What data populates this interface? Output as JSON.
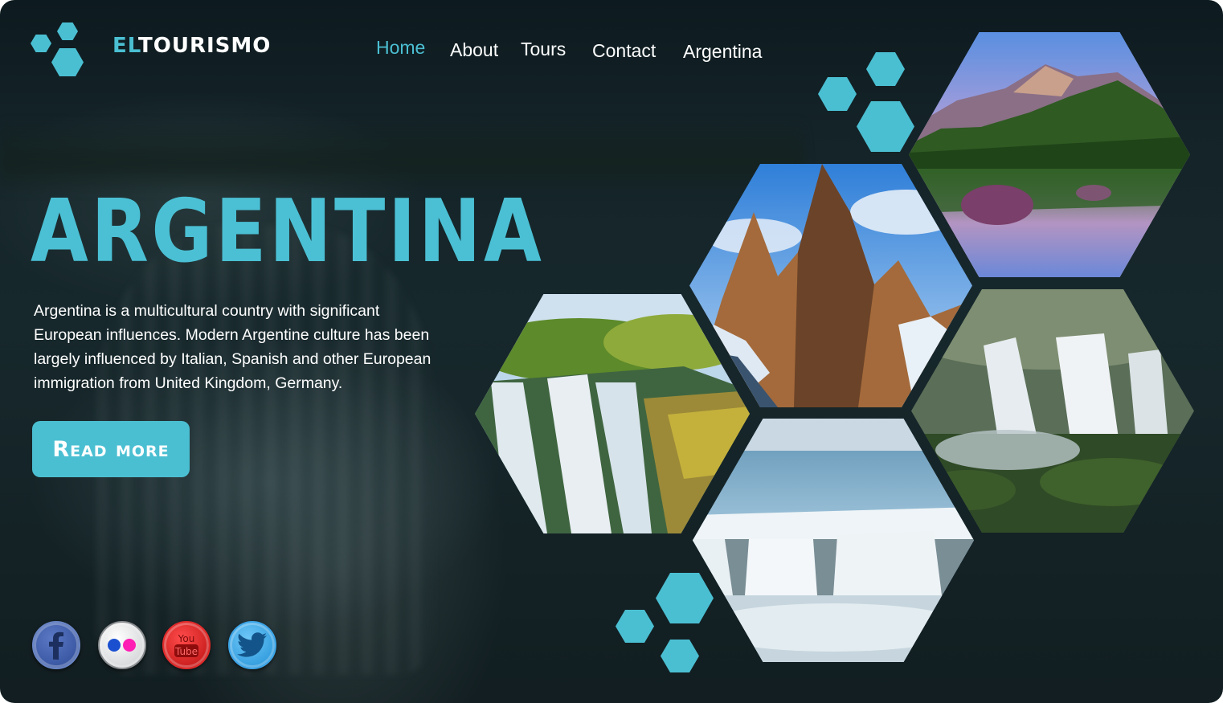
{
  "brand": {
    "prefix": "El",
    "name": "TOURISMO"
  },
  "nav": {
    "home": "Home",
    "about": "About",
    "tours": "Tours",
    "contact": "Contact",
    "argentina": "Argentina"
  },
  "hero": {
    "title": "ARGENTINA",
    "description": "Argentina is a multicultural country with significant European influences. Modern Argentine culture has been largely influenced by Italian, Spanish and other European immigration from United Kingdom, Germany.",
    "cta": "Read more"
  },
  "social": {
    "youtube_top": "You",
    "youtube_bottom": "Tube"
  },
  "colors": {
    "accent": "#4bbfd2",
    "text": "#ffffff",
    "background": "#142328"
  },
  "icons": [
    "hexagon-logo-icon",
    "facebook-icon",
    "flickr-icon",
    "youtube-icon",
    "twitter-icon"
  ],
  "gallery": [
    "mountain-lake-photo",
    "mountain-peaks-photo",
    "waterfall-jungle-photo",
    "waterfall-forest-photo",
    "waterfall-river-photo"
  ]
}
